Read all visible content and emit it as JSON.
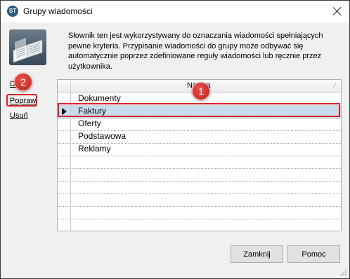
{
  "window": {
    "title": "Grupy wiadomości",
    "app_icon_text": "ST",
    "icon_name": "app-icon"
  },
  "description": "Słownik ten jest wykorzystywany do oznaczania wiadomości spełniających pewne kryteria. Przypisanie wiadomości do grupy może odbywać się automatycznie poprzez zdefiniowane reguły wiadomości lub ręcznie przez użytkownika.",
  "actions": {
    "add_label": "Dodaj",
    "edit_label": "Popraw",
    "delete_label": "Usuń"
  },
  "grid": {
    "column_header": "Nazwa",
    "selected_index": 1,
    "rows": [
      "Dokumenty",
      "Faktury",
      "Oferty",
      "Podstawowa",
      "Reklamy",
      "",
      "",
      "",
      "",
      "",
      ""
    ]
  },
  "callouts": {
    "badge_1": "1",
    "badge_2": "2",
    "accent_color": "#d9232c"
  },
  "buttons": {
    "close_label": "Zamknij",
    "help_label": "Pomoc"
  }
}
